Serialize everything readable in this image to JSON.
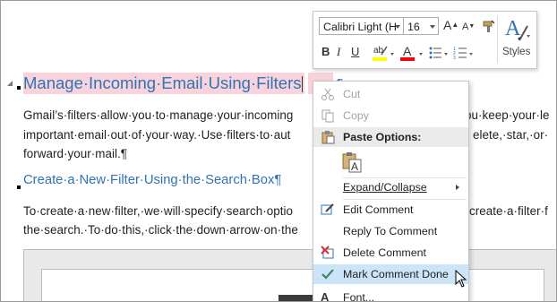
{
  "document": {
    "heading1": "Manage·Incoming·Email·Using·Filters",
    "heading1_after": "¶",
    "para1": [
      "Gmail’s·filters·allow·you·to·manage·your·incoming",
      "important·email·out·of·your·way.·Use·filters·to·aut",
      "forward·your·mail.¶"
    ],
    "para1_right": [
      "ou·keep·your·le",
      "elete,·star,·or·"
    ],
    "heading2": "Create·a·New·Filter·Using·the·Search·Box¶",
    "para2": [
      "To·create·a·new·filter,·we·will·specify·search·optio",
      "the·search.·To·do·this,·click·the·down·arrow·on·the"
    ],
    "para2_right": [
      "create·a·filter·f"
    ]
  },
  "mini_toolbar": {
    "font_name": "Calibri Light (H",
    "font_size": "16",
    "grow_font": "A",
    "shrink_font": "A",
    "bold": "B",
    "italic": "I",
    "underline": "U",
    "styles_label": "Styles",
    "colors": {
      "highlight": "#ffff00",
      "font_color": "#ff0000",
      "styles_accent": "#2e74b5"
    }
  },
  "context_menu": {
    "items": [
      {
        "label": "Cut",
        "underline_char": "t",
        "icon": "scissors-icon",
        "state": "disabled"
      },
      {
        "label": "Copy",
        "underline_char": "C",
        "icon": "copy-icon",
        "state": "disabled"
      },
      {
        "label": "Paste Options:",
        "icon": "paste-icon",
        "state": "header"
      },
      {
        "label": "Expand/Collapse",
        "icon": "",
        "state": "normal",
        "submenu": true
      },
      {
        "label": "Edit Comment",
        "icon": "edit-comment-icon",
        "state": "normal"
      },
      {
        "label": "Reply To Comment",
        "icon": "",
        "state": "normal"
      },
      {
        "label": "Delete Comment",
        "icon": "delete-comment-icon",
        "state": "normal"
      },
      {
        "label": "Mark Comment Done",
        "icon": "checkmark-icon",
        "state": "hover"
      },
      {
        "label": "Font...",
        "icon": "font-icon",
        "state": "normal"
      }
    ]
  }
}
